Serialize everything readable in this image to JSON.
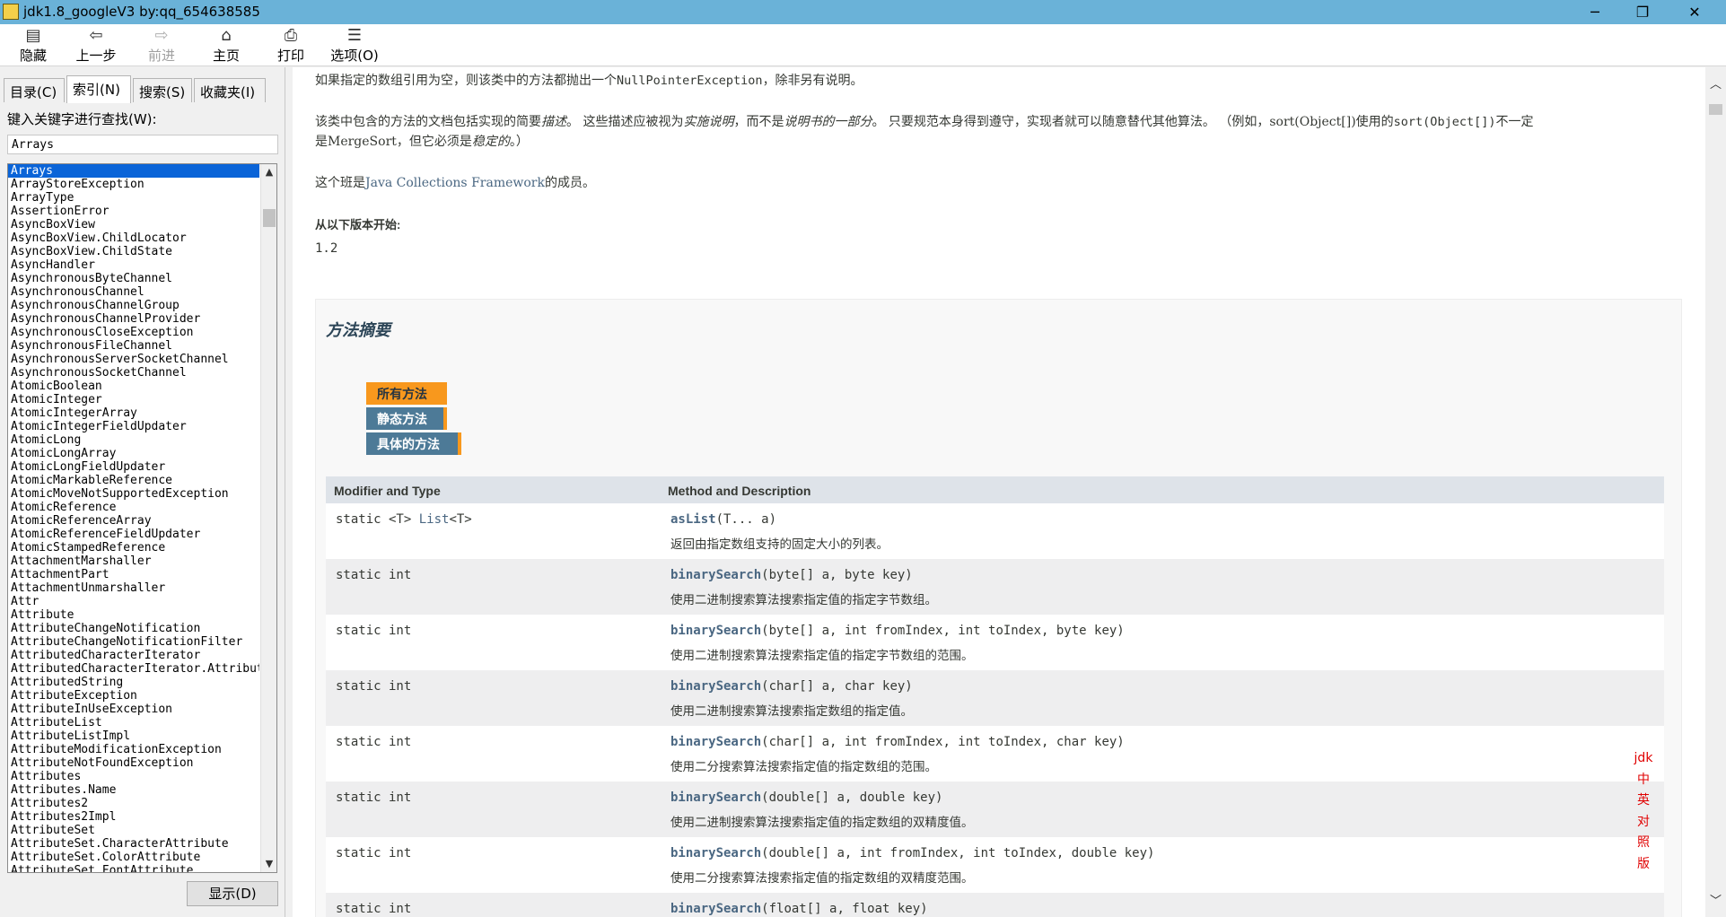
{
  "window": {
    "title": "jdk1.8_googleV3 by:qq_654638585",
    "minimize": "─",
    "restore": "❐",
    "close": "✕"
  },
  "toolbar": {
    "hide": {
      "label": "隐藏",
      "icon": "hide-icon"
    },
    "back": {
      "label": "上一步",
      "icon": "back-arrow-icon"
    },
    "forward": {
      "label": "前进",
      "icon": "forward-arrow-icon"
    },
    "home": {
      "label": "主页",
      "icon": "home-icon"
    },
    "print": {
      "label": "打印",
      "icon": "printer-icon"
    },
    "options": {
      "label": "选项(O)",
      "icon": "options-icon"
    }
  },
  "left": {
    "tabs": [
      {
        "label": "目录(C)"
      },
      {
        "label": "索引(N)",
        "active": true
      },
      {
        "label": "搜索(S)"
      },
      {
        "label": "收藏夹(I)"
      }
    ],
    "search_label": "键入关键字进行查找(W):",
    "search_value": "Arrays",
    "items": [
      "Arrays",
      "ArrayStoreException",
      "ArrayType",
      "AssertionError",
      "AsyncBoxView",
      "AsyncBoxView.ChildLocator",
      "AsyncBoxView.ChildState",
      "AsyncHandler",
      "AsynchronousByteChannel",
      "AsynchronousChannel",
      "AsynchronousChannelGroup",
      "AsynchronousChannelProvider",
      "AsynchronousCloseException",
      "AsynchronousFileChannel",
      "AsynchronousServerSocketChannel",
      "AsynchronousSocketChannel",
      "AtomicBoolean",
      "AtomicInteger",
      "AtomicIntegerArray",
      "AtomicIntegerFieldUpdater",
      "AtomicLong",
      "AtomicLongArray",
      "AtomicLongFieldUpdater",
      "AtomicMarkableReference",
      "AtomicMoveNotSupportedException",
      "AtomicReference",
      "AtomicReferenceArray",
      "AtomicReferenceFieldUpdater",
      "AtomicStampedReference",
      "AttachmentMarshaller",
      "AttachmentPart",
      "AttachmentUnmarshaller",
      "Attr",
      "Attribute",
      "AttributeChangeNotification",
      "AttributeChangeNotificationFilter",
      "AttributedCharacterIterator",
      "AttributedCharacterIterator.Attribute",
      "AttributedString",
      "AttributeException",
      "AttributeInUseException",
      "AttributeList",
      "AttributeListImpl",
      "AttributeModificationException",
      "AttributeNotFoundException",
      "Attributes",
      "Attributes.Name",
      "Attributes2",
      "Attributes2Impl",
      "AttributeSet",
      "AttributeSet.CharacterAttribute",
      "AttributeSet.ColorAttribute",
      "AttributeSet.FontAttribute"
    ],
    "display_button": "显示(D)"
  },
  "doc": {
    "p1_a": "如果指定的数组引用为空，则该类中的方法都抛出一个",
    "p1_code": "NullPointerException",
    "p1_b": "，除非另有说明。",
    "p2_a": "该类中包含的方法的文档包括实现的简要",
    "p2_em1": "描述",
    "p2_b": "。 这些描述应被视为",
    "p2_em2": "实施说明",
    "p2_c": "，而不是",
    "p2_em3": "说明书的一部分",
    "p2_d": "。 只要规范本身得到遵守，实现者就可以随意替代其他算法。 （例如，sort(Object[])使用的",
    "p2_code": "sort(Object[])",
    "p2_e": "不一定",
    "p2_line2_a": "是MergeSort，但它必须是",
    "p2_em4": "稳定的",
    "p2_line2_b": "。）",
    "p3_a": "这个班是",
    "p3_link": "Java Collections Framework",
    "p3_b": "的成员。",
    "since_label": "从以下版本开始:",
    "since_value": "1.2"
  },
  "summary": {
    "title": "方法摘要",
    "tabs": [
      {
        "label": "所有方法",
        "active": true
      },
      {
        "label": "静态方法"
      },
      {
        "label": "具体的方法"
      }
    ],
    "col1": "Modifier and Type",
    "col2": "Method and Description",
    "rows": [
      {
        "type_a": "static <T> ",
        "type_link": "List",
        "type_b": "<T>",
        "name": "asList",
        "params": "(T... a)",
        "desc": "返回由指定数组支持的固定大小的列表。"
      },
      {
        "type_a": "static int",
        "type_link": "",
        "type_b": "",
        "name": "binarySearch",
        "params": "(byte[] a, byte key)",
        "desc": "使用二进制搜索算法搜索指定值的指定字节数组。"
      },
      {
        "type_a": "static int",
        "type_link": "",
        "type_b": "",
        "name": "binarySearch",
        "params": "(byte[] a, int fromIndex, int toIndex, byte key)",
        "desc": "使用二进制搜索算法搜索指定值的指定字节数组的范围。"
      },
      {
        "type_a": "static int",
        "type_link": "",
        "type_b": "",
        "name": "binarySearch",
        "params": "(char[] a, char key)",
        "desc": "使用二进制搜索算法搜索指定数组的指定值。"
      },
      {
        "type_a": "static int",
        "type_link": "",
        "type_b": "",
        "name": "binarySearch",
        "params": "(char[] a, int fromIndex, int toIndex, char key)",
        "desc": "使用二分搜索算法搜索指定值的指定数组的范围。"
      },
      {
        "type_a": "static int",
        "type_link": "",
        "type_b": "",
        "name": "binarySearch",
        "params": "(double[] a, double key)",
        "desc": "使用二进制搜索算法搜索指定值的指定数组的双精度值。"
      },
      {
        "type_a": "static int",
        "type_link": "",
        "type_b": "",
        "name": "binarySearch",
        "params": "(double[] a, int fromIndex, int toIndex, double key)",
        "desc": "使用二分搜索算法搜索指定值的指定数组的双精度范围。"
      },
      {
        "type_a": "static int",
        "type_link": "",
        "type_b": "",
        "name": "binarySearch",
        "params": "(float[] a, float key)",
        "desc": ""
      }
    ]
  },
  "watermark": [
    "jdk",
    "中",
    "英",
    "对",
    "照",
    "版"
  ],
  "colors": {
    "selected": "#0a64d8",
    "tab_active": "#f8981d",
    "tab_inactive": "#4d7a97",
    "watermark": "#e00000"
  }
}
